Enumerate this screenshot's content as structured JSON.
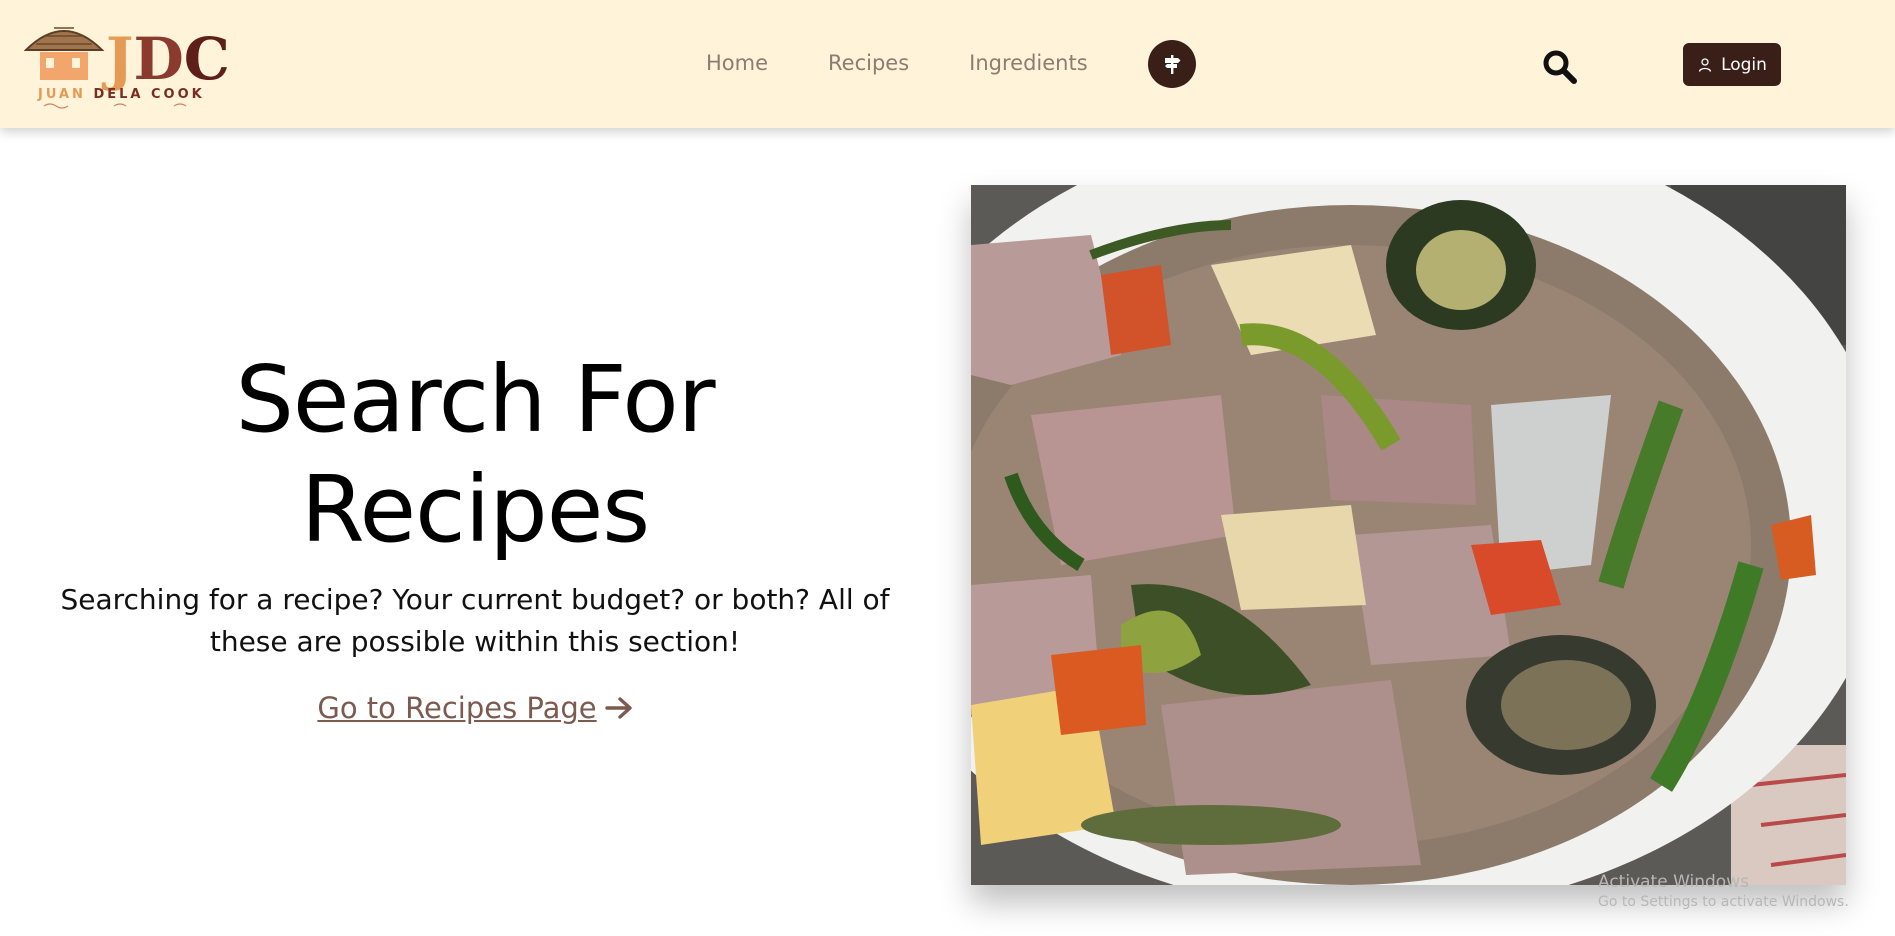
{
  "brand": {
    "logo_text": "JDC",
    "logo_subtext": "JUAN DELA COOK",
    "colors": {
      "navbar_bg": "#fff4d9",
      "accent_dark": "#3a1f19",
      "link_brown": "#7d5a50"
    }
  },
  "nav": {
    "links": [
      {
        "label": "Home"
      },
      {
        "label": "Recipes"
      },
      {
        "label": "Ingredients"
      }
    ],
    "circle_icon": "signpost-icon",
    "search_icon": "search-icon",
    "login_label": "Login",
    "login_icon": "user-icon"
  },
  "hero": {
    "title_line1": "Search For",
    "title_line2": "Recipes",
    "description": "Searching for a recipe? Your current budget? or both? All of these are possible within this section!",
    "link_label": "Go to Recipes Page",
    "link_icon": "arrow-right-icon",
    "image_alt": "sinigang-soup-image"
  },
  "watermark": {
    "line1": "Activate Windows",
    "line2": "Go to Settings to activate Windows."
  }
}
